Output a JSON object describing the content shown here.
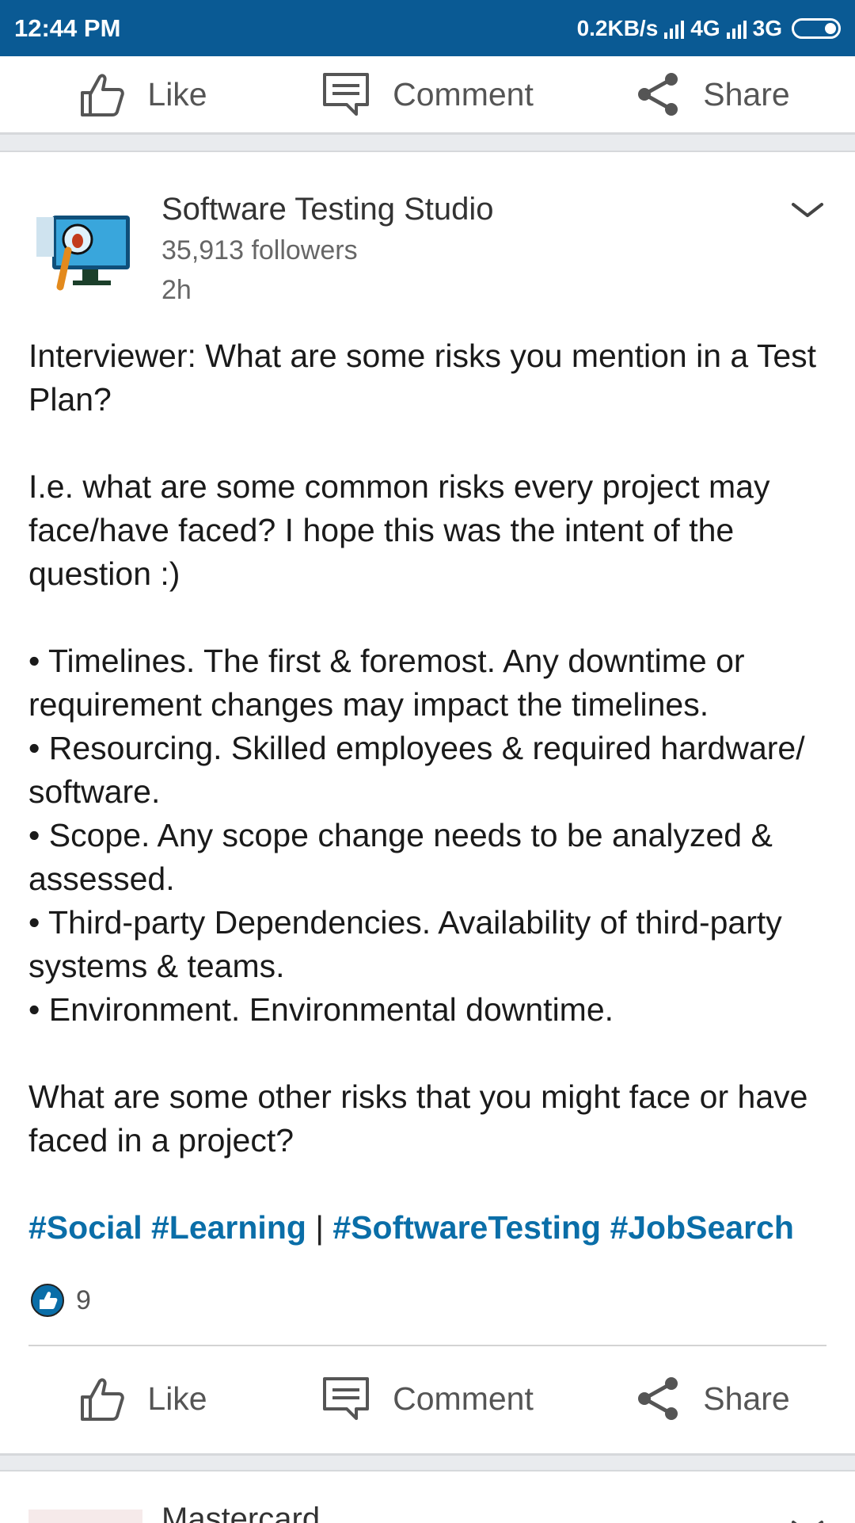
{
  "status_bar": {
    "time": "12:44 PM",
    "speed": "0.2KB/s",
    "network1": "4G",
    "network2": "3G"
  },
  "actions": {
    "like": "Like",
    "comment": "Comment",
    "share": "Share"
  },
  "post": {
    "company": "Software Testing Studio",
    "followers": "35,913 followers",
    "time": "2h",
    "body": [
      "Interviewer: What are some risks you mention in a Test Plan?",
      "",
      "I.e. what are some common risks every project may face/have faced? I hope this was the intent of the question :)",
      "",
      "• Timelines. The first & foremost. Any downtime or requirement changes may impact the timelines.",
      "• Resourcing. Skilled employees & required hardware/ software.",
      "• Scope. Any scope change needs to be analyzed & assessed.",
      "• Third-party Dependencies. Availability of third-party systems & teams.",
      "• Environment. Environmental downtime.",
      "",
      "What are some other risks that you might face or have faced in a project?"
    ],
    "hashtags": {
      "part1": "#Social #Learning",
      "separator": "|",
      "part2": "#SoftwareTesting #JobSearch"
    },
    "reaction_count": "9"
  },
  "next_post": {
    "company": "Mastercard"
  },
  "colors": {
    "status_bar": "#0a5a94",
    "hashtag": "#0a6ea8",
    "like_badge": "#0a6ea8"
  }
}
